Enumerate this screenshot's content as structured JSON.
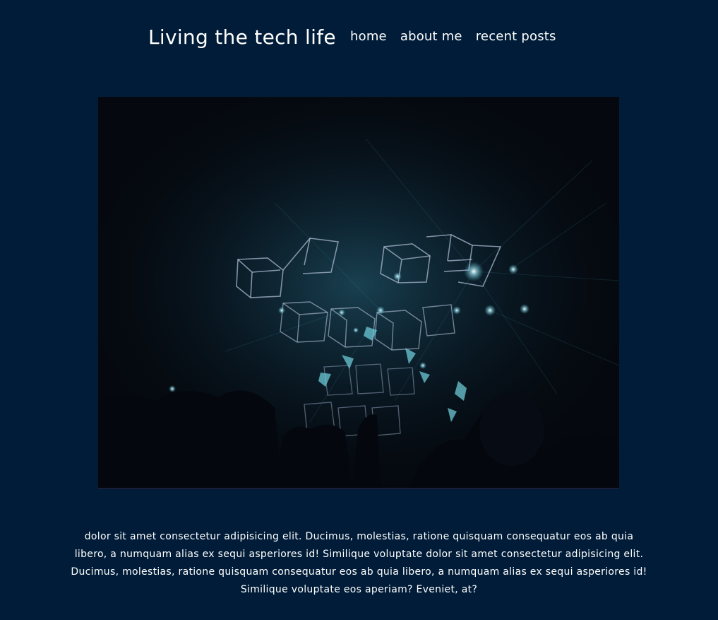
{
  "header": {
    "site_title": "Living the tech life",
    "nav": [
      {
        "label": "home"
      },
      {
        "label": "about me"
      },
      {
        "label": "recent posts"
      }
    ]
  },
  "hero": {
    "image_description_icon": "concert-light-cubes-image",
    "background_color": "#06101a",
    "light_color": "#4fb3c8"
  },
  "article": {
    "body": "dolor sit amet consectetur adipisicing elit. Ducimus, molestias, ratione quisquam consequatur eos ab quia libero, a numquam alias ex sequi asperiores id! Similique voluptate dolor sit amet consectetur adipisicing elit. Ducimus, molestias, ratione quisquam consequatur eos ab quia libero, a numquam alias ex sequi asperiores id! Similique voluptate eos aperiam? Eveniet, at?"
  },
  "theme": {
    "page_background": "#001c38",
    "text_color": "#ffffff"
  }
}
